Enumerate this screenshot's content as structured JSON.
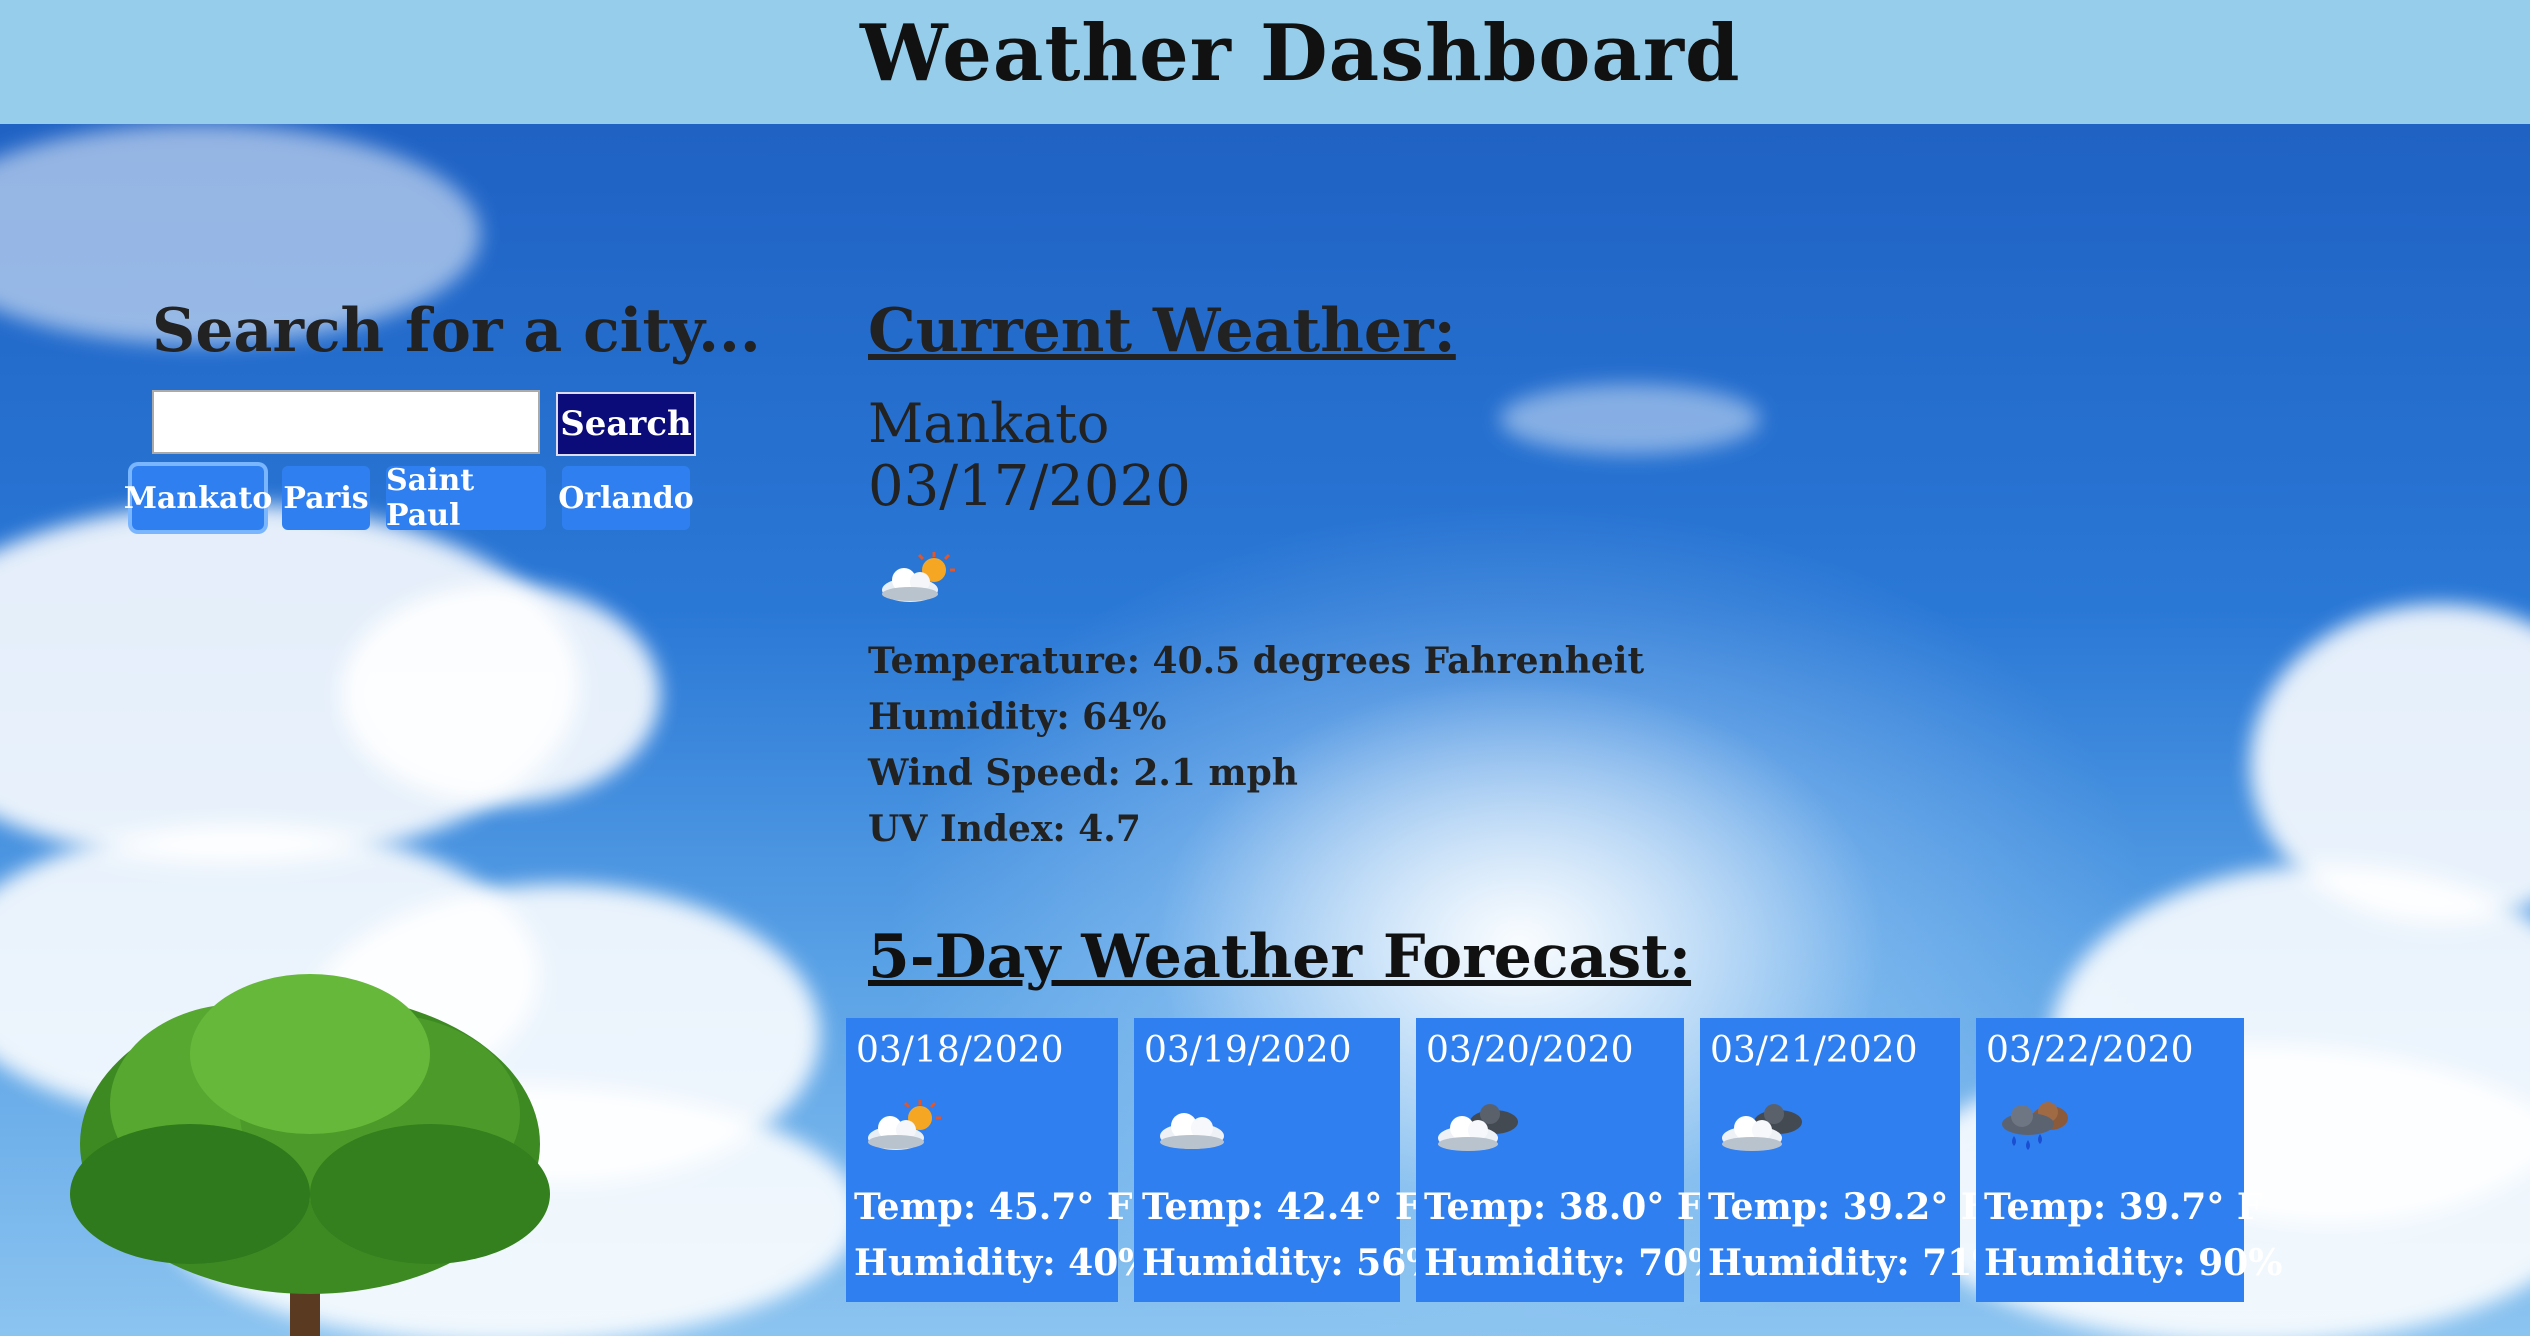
{
  "header": {
    "title": "Weather Dashboard"
  },
  "search": {
    "title": "Search for a city...",
    "input_value": "",
    "placeholder": "",
    "button_label": "Search",
    "history": [
      "Mankato",
      "Paris",
      "Saint Paul",
      "Orlando"
    ],
    "active_history": "Mankato"
  },
  "current": {
    "title": "Current Weather:",
    "city": "Mankato",
    "date": "03/17/2020",
    "icon": "partly-sunny-icon",
    "temperature": "Temperature: 40.5 degrees Fahrenheit",
    "humidity": "Humidity: 64%",
    "wind": "Wind Speed: 2.1 mph",
    "uv": "UV Index: 4.7"
  },
  "forecast": {
    "title": "5-Day Weather Forecast:",
    "days": [
      {
        "date": "03/18/2020",
        "icon": "partly-sunny-icon",
        "temp": "Temp: 45.7° F",
        "humidity": "Humidity: 40%"
      },
      {
        "date": "03/19/2020",
        "icon": "cloud-icon",
        "temp": "Temp: 42.4° F",
        "humidity": "Humidity: 56%"
      },
      {
        "date": "03/20/2020",
        "icon": "overcast-icon",
        "temp": "Temp: 38.0° F",
        "humidity": "Humidity: 70%"
      },
      {
        "date": "03/21/2020",
        "icon": "overcast-icon",
        "temp": "Temp: 39.2° F",
        "humidity": "Humidity: 71%"
      },
      {
        "date": "03/22/2020",
        "icon": "rain-icon",
        "temp": "Temp: 39.7° F",
        "humidity": "Humidity: 90%"
      }
    ]
  },
  "colors": {
    "header_bg": "#96cdea",
    "button_blue": "#2f7ff0",
    "search_button": "#0b0b7a"
  }
}
